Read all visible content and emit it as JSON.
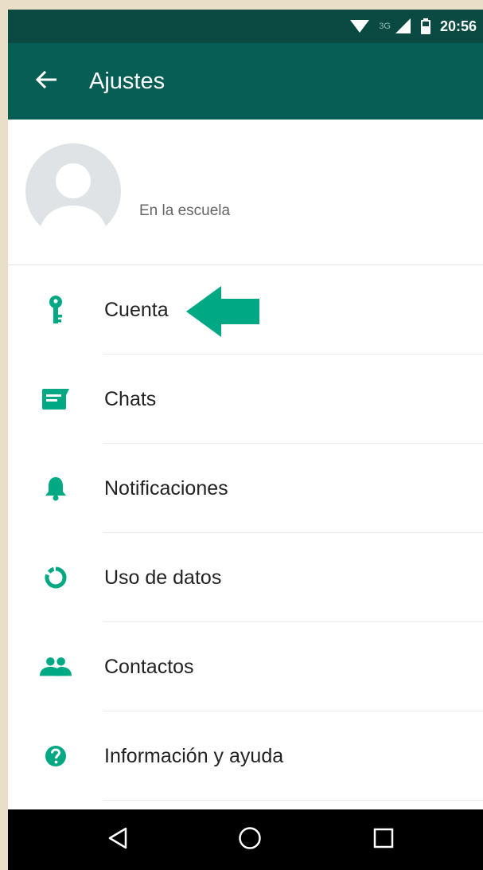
{
  "status_bar": {
    "network": "3G",
    "time": "20:56"
  },
  "header": {
    "title": "Ajustes"
  },
  "profile": {
    "status": "En la escuela"
  },
  "menu": {
    "items": [
      {
        "label": "Cuenta",
        "icon": "key-icon"
      },
      {
        "label": "Chats",
        "icon": "chat-icon"
      },
      {
        "label": "Notificaciones",
        "icon": "bell-icon"
      },
      {
        "label": "Uso de datos",
        "icon": "data-usage-icon"
      },
      {
        "label": "Contactos",
        "icon": "contacts-icon"
      },
      {
        "label": "Información y ayuda",
        "icon": "help-icon"
      }
    ]
  },
  "colors": {
    "header": "#075e54",
    "status_bar": "#0a4a42",
    "accent": "#00a884",
    "nav_bar": "#000000"
  }
}
